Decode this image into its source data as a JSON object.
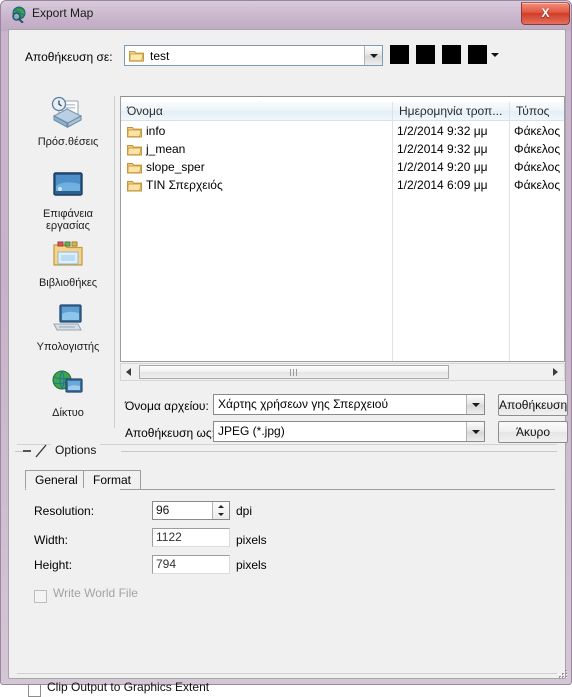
{
  "window": {
    "title": "Export Map",
    "icon": "globe-magnifier-icon",
    "close_label": "X"
  },
  "browse": {
    "look_in_label": "Αποθήκευση σε:",
    "look_in_value": "test",
    "toolbar_icons": [
      "back-icon",
      "up-one-level-icon",
      "new-folder-icon",
      "views-icon"
    ],
    "views_caret": "chevron-down-icon"
  },
  "file_list": {
    "columns": [
      "Όνομα",
      "Ημερομηνία τροπ...",
      "Τύπος"
    ],
    "sort_indicator": "sort-ascending-icon",
    "rows": [
      {
        "name": "info",
        "date": "1/2/2014 9:32 μμ",
        "type": "Φάκελος α"
      },
      {
        "name": "j_mean",
        "date": "1/2/2014 9:32 μμ",
        "type": "Φάκελος α"
      },
      {
        "name": "slope_sper",
        "date": "1/2/2014 9:20 μμ",
        "type": "Φάκελος α"
      },
      {
        "name": "TIN Σπερχειός",
        "date": "1/2/2014 6:09 μμ",
        "type": "Φάκελος α"
      }
    ]
  },
  "places": [
    {
      "label_line1": "Πρόσ.θέσεις",
      "label_line2": "",
      "icon": "recent-places-icon"
    },
    {
      "label_line1": "Επιφάνεια",
      "label_line2": "εργασίας",
      "icon": "desktop-icon"
    },
    {
      "label_line1": "Βιβλιοθήκες",
      "label_line2": "",
      "icon": "libraries-icon"
    },
    {
      "label_line1": "Υπολογιστής",
      "label_line2": "",
      "icon": "computer-icon"
    },
    {
      "label_line1": "Δίκτυο",
      "label_line2": "",
      "icon": "network-icon"
    }
  ],
  "filename": {
    "name_label": "Όνομα αρχείου:",
    "name_value": "Χάρτης χρήσεων γης Σπερχειού",
    "type_label": "Αποθήκευση ως:",
    "type_value": "JPEG (*.jpg)",
    "save_button": "Αποθήκευση",
    "cancel_button": "Άκυρο"
  },
  "options": {
    "group_title": "Options",
    "tabs": [
      {
        "label": "General",
        "selected": true
      },
      {
        "label": "Format",
        "selected": false
      }
    ],
    "fields": [
      {
        "label": "Resolution:",
        "value": "96",
        "unit": "dpi",
        "has_spinner": true,
        "enabled": true
      },
      {
        "label": "Width:",
        "value": "1122",
        "unit": "pixels",
        "has_spinner": false,
        "enabled": true
      },
      {
        "label": "Height:",
        "value": "794",
        "unit": "pixels",
        "has_spinner": false,
        "enabled": true
      }
    ],
    "write_world_file": {
      "label": "Write World File",
      "checked": false,
      "enabled": false
    }
  },
  "footer": {
    "clip_output": {
      "label": "Clip Output to Graphics Extent",
      "checked": false
    }
  }
}
